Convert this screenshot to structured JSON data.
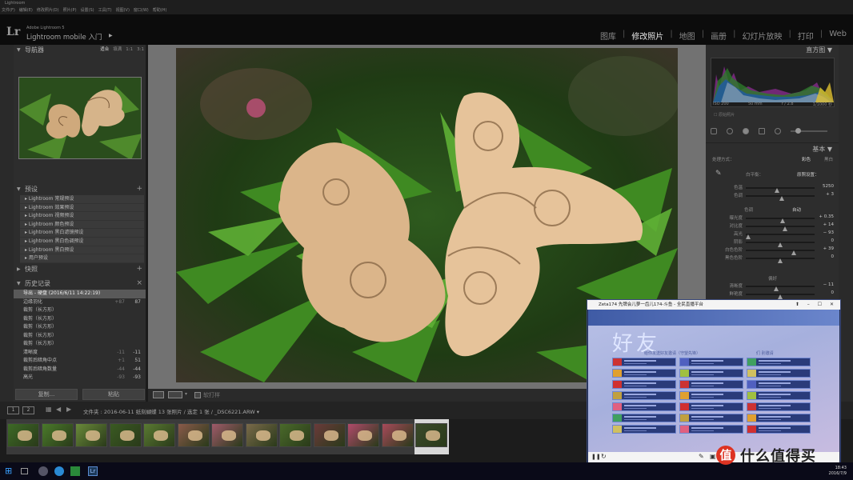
{
  "window": {
    "title": "Lightroom"
  },
  "menu": [
    "文件(F)",
    "编辑(E)",
    "修改照片(D)",
    "照片(P)",
    "设置(S)",
    "工具(T)",
    "视图(V)",
    "窗口(W)",
    "帮助(H)"
  ],
  "identity": {
    "logo": "Lr",
    "product": "Adobe Lightroom 5",
    "plate": "Lightroom mobile 入门",
    "play": "▶"
  },
  "modules": [
    "图库",
    "修改照片",
    "地图",
    "画册",
    "幻灯片放映",
    "打印",
    "Web"
  ],
  "active_module": "修改照片",
  "navigator": {
    "title": "导航器",
    "options": [
      "适合",
      "填满",
      "1:1",
      "3:1"
    ],
    "selected": "适合"
  },
  "presets": {
    "title": "预设",
    "items": [
      "Lightroom 常规预设",
      "Lightroom 效果预设",
      "Lightroom 视频预设",
      "Lightroom 颜色预设",
      "Lightroom 黑白滤镜预设",
      "Lightroom 黑白色调预设",
      "Lightroom 黑白预设",
      "用户预设"
    ]
  },
  "snapshots": {
    "title": "快照"
  },
  "history": {
    "title": "历史记录",
    "items": [
      {
        "label": "导出 - 硬盘 (2016/6/11 14:22:19)",
        "v1": "",
        "v2": ""
      },
      {
        "label": "边缘羽化",
        "v1": "+87",
        "v2": "87"
      },
      {
        "label": "裁剪（长方形）",
        "v1": "",
        "v2": ""
      },
      {
        "label": "裁剪（长方形）",
        "v1": "",
        "v2": ""
      },
      {
        "label": "裁剪（长方形）",
        "v1": "",
        "v2": ""
      },
      {
        "label": "裁剪（长方形）",
        "v1": "",
        "v2": ""
      },
      {
        "label": "裁剪（长方形）",
        "v1": "",
        "v2": ""
      },
      {
        "label": "清晰度",
        "v1": "-11",
        "v2": "-11"
      },
      {
        "label": "裁剪后暗角中点",
        "v1": "+1",
        "v2": "51"
      },
      {
        "label": "裁剪后暗角数量",
        "v1": "-44",
        "v2": "-44"
      },
      {
        "label": "高光",
        "v1": "-93",
        "v2": "-93"
      }
    ]
  },
  "left_buttons": {
    "copy": "复制...",
    "paste": "粘贴"
  },
  "toolbar": {
    "softproof": "软打样"
  },
  "right": {
    "histogram_title": "直方图",
    "exif": [
      "ISO 200",
      "50 mm",
      "f / 2.8",
      "1/1000 秒"
    ],
    "original": "原始照片",
    "basic_title": "基本",
    "treatment": "处理方式：",
    "color": "彩色",
    "bw": "黑白",
    "wb_label": "白平衡：",
    "wb_value": "原照设置：",
    "tone_label": "色调",
    "auto": "自动",
    "presence_label": "偏好",
    "sliders_wb": [
      {
        "label": "色温",
        "value": "5250",
        "pos": 0.45
      },
      {
        "label": "色调",
        "value": "+ 3",
        "pos": 0.52
      }
    ],
    "sliders_tone": [
      {
        "label": "曝光度",
        "value": "+ 0.35",
        "pos": 0.53
      },
      {
        "label": "对比度",
        "value": "+ 14",
        "pos": 0.57
      },
      {
        "label": "高光",
        "value": "− 93",
        "pos": 0.03
      },
      {
        "label": "阴影",
        "value": "0",
        "pos": 0.5
      },
      {
        "label": "白色色阶",
        "value": "+ 39",
        "pos": 0.7
      },
      {
        "label": "黑色色阶",
        "value": "0",
        "pos": 0.5
      }
    ],
    "sliders_presence": [
      {
        "label": "清晰度",
        "value": "− 11",
        "pos": 0.44
      },
      {
        "label": "鲜艳度",
        "value": "0",
        "pos": 0.5
      }
    ]
  },
  "filmstrip": {
    "pages": [
      "1",
      "2"
    ],
    "info": "文件夹 : 2016-06-11 纸刻蝴蝶    13 张照片 / 选定 1 张 / _DSC6221.ARW ▾"
  },
  "overlay": {
    "title": "Zeta174 先牌会儿萝一齿儿174-斗鱼 - 全民直播平台",
    "big": "好友",
    "sub": "给你发送好友邀请（守望先锋）",
    "sub2": "们 别邀请"
  },
  "taskbar": {
    "time": "18:43",
    "date": "2016/7/9"
  },
  "watermark": {
    "logo": "值",
    "text": "什么值得买"
  }
}
